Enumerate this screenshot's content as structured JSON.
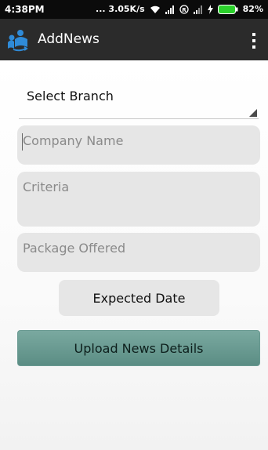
{
  "status_bar": {
    "time": "4:38PM",
    "network_speed": "... 3.05K/s",
    "battery": "82%",
    "icons": [
      "wifi-icon",
      "signal-icon",
      "roaming-icon",
      "signal-icon",
      "charging-icon",
      "battery-icon"
    ]
  },
  "app_bar": {
    "title": "AddNews",
    "logo_icon": "app-logo-icon",
    "menu_icon": "overflow-menu-icon",
    "background": "#2b2b2b"
  },
  "form": {
    "branch_spinner": {
      "label": "Select Branch"
    },
    "company_name": {
      "placeholder": "Company Name",
      "value": ""
    },
    "criteria": {
      "placeholder": "Criteria",
      "value": ""
    },
    "package_offered": {
      "placeholder": "Package Offered",
      "value": ""
    },
    "expected_date_button": "Expected Date",
    "upload_button": "Upload News Details"
  },
  "colors": {
    "status_bar": "#0b0b0b",
    "field_bg": "#e6e6e6",
    "upload_button": "#6f9f96"
  }
}
